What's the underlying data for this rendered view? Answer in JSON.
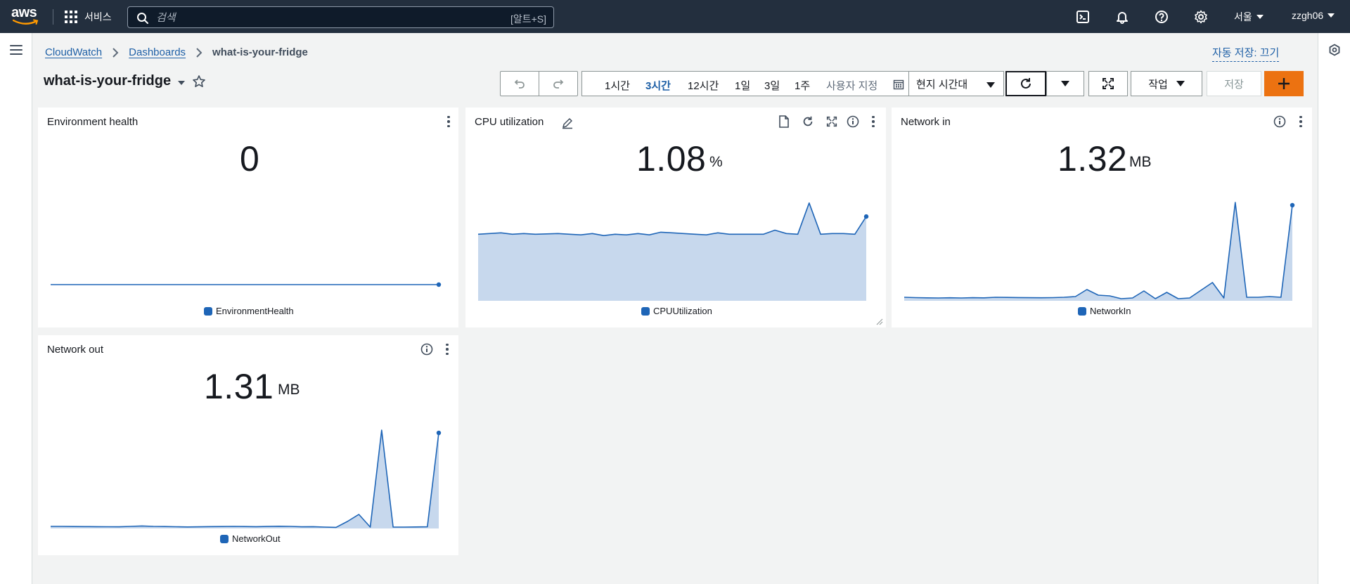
{
  "nav": {
    "logo_text": "aws",
    "services_label": "서비스",
    "search_placeholder": "검색",
    "search_shortcut": "[알트+S]",
    "region": "서울",
    "user": "zzgh06"
  },
  "breadcrumb": {
    "items": [
      "CloudWatch",
      "Dashboards"
    ],
    "current": "what-is-your-fridge"
  },
  "autosave_label": "자동 저장: 끄기",
  "dashboard_title": "what-is-your-fridge",
  "toolbar": {
    "ranges": [
      "1시간",
      "3시간",
      "12시간",
      "1일",
      "3일",
      "1주"
    ],
    "active_range": "3시간",
    "custom_label": "사용자 지정",
    "timezone": "현지 시간대",
    "actions_label": "작업",
    "save_label": "저장",
    "add_label": "+"
  },
  "widgets": [
    {
      "title": "Environment health",
      "value": "0",
      "unit": "",
      "legend": "EnvironmentHealth",
      "color": "#1e65b7"
    },
    {
      "title": "CPU utilization",
      "value": "1.08",
      "unit": "%",
      "legend": "CPUUtilization",
      "color": "#1e65b7"
    },
    {
      "title": "Network in",
      "value": "1.32",
      "unit": "MB",
      "legend": "NetworkIn",
      "color": "#1e65b7"
    },
    {
      "title": "Network out",
      "value": "1.31",
      "unit": "MB",
      "legend": "NetworkOut",
      "color": "#1e65b7"
    }
  ],
  "chart_data": [
    {
      "type": "line",
      "series": [
        {
          "name": "EnvironmentHealth",
          "values": [
            0,
            0,
            0,
            0,
            0,
            0,
            0,
            0,
            0,
            0,
            0,
            0,
            0,
            0,
            0,
            0,
            0,
            0,
            0,
            0,
            0,
            0,
            0,
            0,
            0,
            0,
            0,
            0,
            0,
            0,
            0,
            0,
            0,
            0,
            0,
            0,
            0
          ]
        }
      ],
      "ylim": [
        0,
        1
      ]
    },
    {
      "type": "area",
      "series": [
        {
          "name": "CPUUtilization",
          "values": [
            0.98,
            0.99,
            1.0,
            0.98,
            0.99,
            0.98,
            0.985,
            0.99,
            0.98,
            0.97,
            0.99,
            0.96,
            0.98,
            0.97,
            0.99,
            0.97,
            1.01,
            1.0,
            0.99,
            0.98,
            0.97,
            1.0,
            0.98,
            0.98,
            0.98,
            0.98,
            1.04,
            0.99,
            0.98,
            1.44,
            0.98,
            0.99,
            0.99,
            0.98,
            1.24
          ]
        }
      ],
      "ylim": [
        0,
        1.5
      ]
    },
    {
      "type": "area",
      "series": [
        {
          "name": "NetworkIn",
          "values": [
            0.05,
            0.045,
            0.042,
            0.04,
            0.043,
            0.04,
            0.044,
            0.042,
            0.05,
            0.048,
            0.046,
            0.044,
            0.043,
            0.045,
            0.05,
            0.06,
            0.16,
            0.08,
            0.07,
            0.03,
            0.04,
            0.14,
            0.03,
            0.12,
            0.03,
            0.04,
            0.15,
            0.26,
            0.04,
            1.4,
            0.05,
            0.05,
            0.06,
            0.05,
            1.36
          ]
        }
      ],
      "ylim": [
        0,
        1.45
      ]
    },
    {
      "type": "area",
      "series": [
        {
          "name": "NetworkOut",
          "values": [
            0.03,
            0.03,
            0.028,
            0.027,
            0.026,
            0.025,
            0.024,
            0.03,
            0.036,
            0.03,
            0.028,
            0.025,
            0.022,
            0.024,
            0.027,
            0.028,
            0.03,
            0.028,
            0.026,
            0.029,
            0.032,
            0.03,
            0.024,
            0.026,
            0.02,
            0.016,
            0.1,
            0.2,
            0.02,
            1.4,
            0.02,
            0.02,
            0.022,
            0.024,
            1.36
          ]
        }
      ],
      "ylim": [
        0,
        1.45
      ]
    }
  ]
}
